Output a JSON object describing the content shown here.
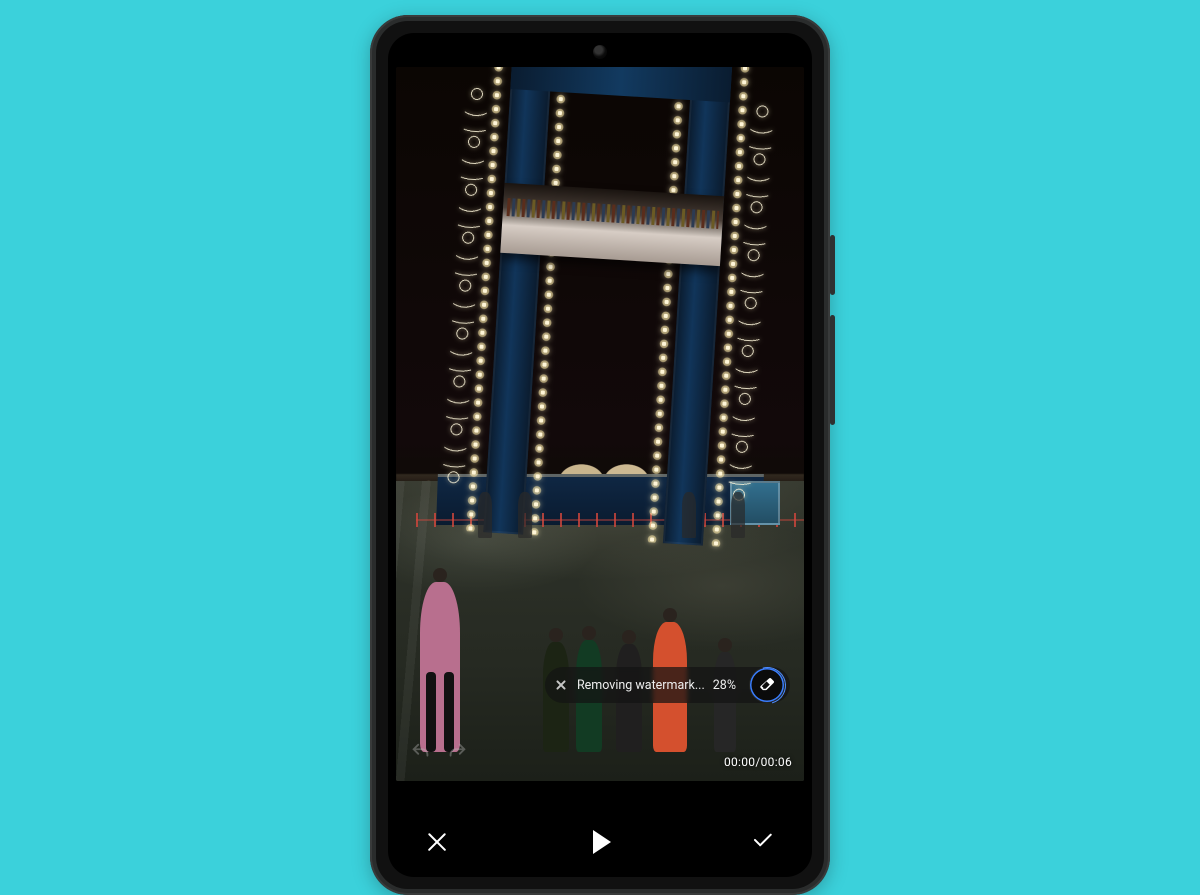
{
  "progress": {
    "label": "Removing watermark...",
    "percent_text": "28%"
  },
  "timecode": {
    "current": "00:00",
    "separator": "/",
    "total": "00:06"
  }
}
